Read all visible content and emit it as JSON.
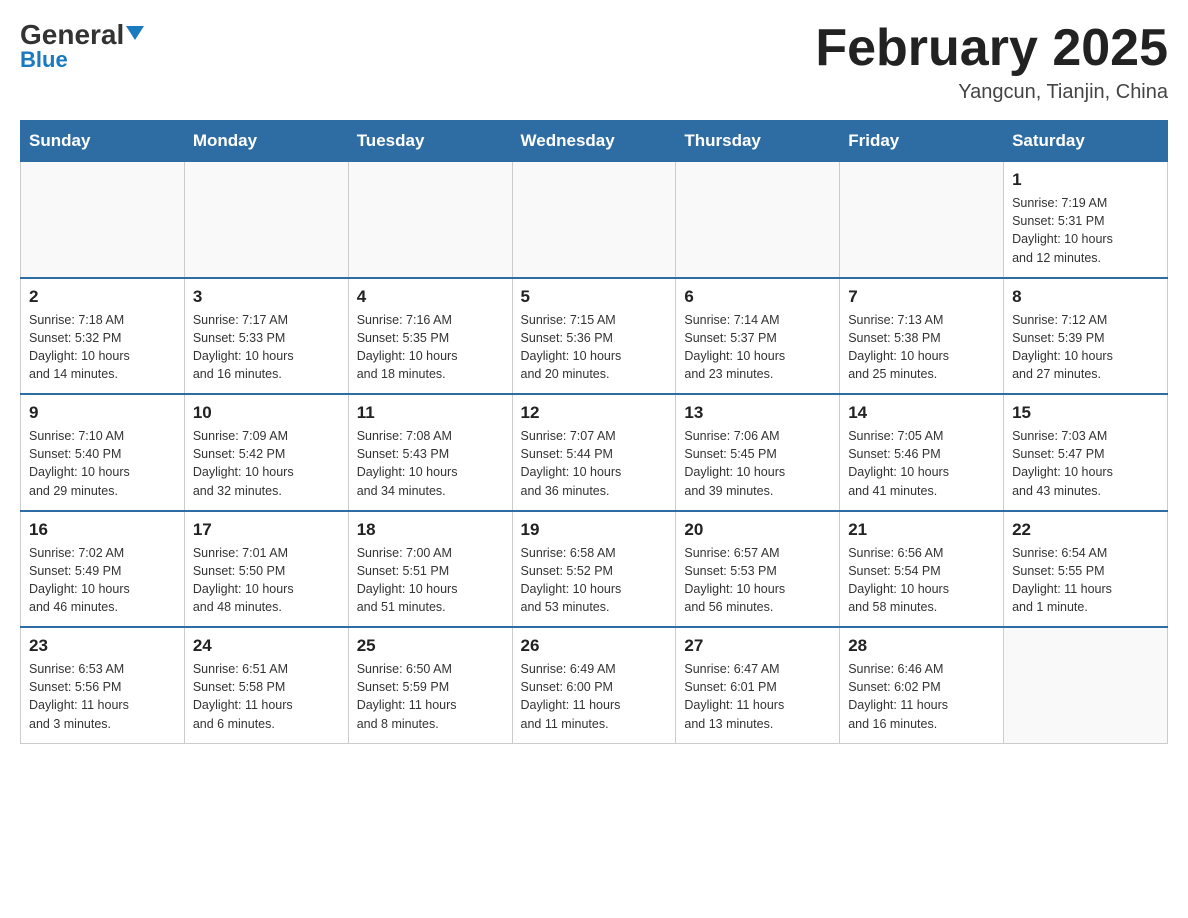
{
  "header": {
    "logo_general": "General",
    "logo_blue": "Blue",
    "month_title": "February 2025",
    "subtitle": "Yangcun, Tianjin, China"
  },
  "weekdays": [
    "Sunday",
    "Monday",
    "Tuesday",
    "Wednesday",
    "Thursday",
    "Friday",
    "Saturday"
  ],
  "weeks": [
    [
      {
        "day": "",
        "info": ""
      },
      {
        "day": "",
        "info": ""
      },
      {
        "day": "",
        "info": ""
      },
      {
        "day": "",
        "info": ""
      },
      {
        "day": "",
        "info": ""
      },
      {
        "day": "",
        "info": ""
      },
      {
        "day": "1",
        "info": "Sunrise: 7:19 AM\nSunset: 5:31 PM\nDaylight: 10 hours\nand 12 minutes."
      }
    ],
    [
      {
        "day": "2",
        "info": "Sunrise: 7:18 AM\nSunset: 5:32 PM\nDaylight: 10 hours\nand 14 minutes."
      },
      {
        "day": "3",
        "info": "Sunrise: 7:17 AM\nSunset: 5:33 PM\nDaylight: 10 hours\nand 16 minutes."
      },
      {
        "day": "4",
        "info": "Sunrise: 7:16 AM\nSunset: 5:35 PM\nDaylight: 10 hours\nand 18 minutes."
      },
      {
        "day": "5",
        "info": "Sunrise: 7:15 AM\nSunset: 5:36 PM\nDaylight: 10 hours\nand 20 minutes."
      },
      {
        "day": "6",
        "info": "Sunrise: 7:14 AM\nSunset: 5:37 PM\nDaylight: 10 hours\nand 23 minutes."
      },
      {
        "day": "7",
        "info": "Sunrise: 7:13 AM\nSunset: 5:38 PM\nDaylight: 10 hours\nand 25 minutes."
      },
      {
        "day": "8",
        "info": "Sunrise: 7:12 AM\nSunset: 5:39 PM\nDaylight: 10 hours\nand 27 minutes."
      }
    ],
    [
      {
        "day": "9",
        "info": "Sunrise: 7:10 AM\nSunset: 5:40 PM\nDaylight: 10 hours\nand 29 minutes."
      },
      {
        "day": "10",
        "info": "Sunrise: 7:09 AM\nSunset: 5:42 PM\nDaylight: 10 hours\nand 32 minutes."
      },
      {
        "day": "11",
        "info": "Sunrise: 7:08 AM\nSunset: 5:43 PM\nDaylight: 10 hours\nand 34 minutes."
      },
      {
        "day": "12",
        "info": "Sunrise: 7:07 AM\nSunset: 5:44 PM\nDaylight: 10 hours\nand 36 minutes."
      },
      {
        "day": "13",
        "info": "Sunrise: 7:06 AM\nSunset: 5:45 PM\nDaylight: 10 hours\nand 39 minutes."
      },
      {
        "day": "14",
        "info": "Sunrise: 7:05 AM\nSunset: 5:46 PM\nDaylight: 10 hours\nand 41 minutes."
      },
      {
        "day": "15",
        "info": "Sunrise: 7:03 AM\nSunset: 5:47 PM\nDaylight: 10 hours\nand 43 minutes."
      }
    ],
    [
      {
        "day": "16",
        "info": "Sunrise: 7:02 AM\nSunset: 5:49 PM\nDaylight: 10 hours\nand 46 minutes."
      },
      {
        "day": "17",
        "info": "Sunrise: 7:01 AM\nSunset: 5:50 PM\nDaylight: 10 hours\nand 48 minutes."
      },
      {
        "day": "18",
        "info": "Sunrise: 7:00 AM\nSunset: 5:51 PM\nDaylight: 10 hours\nand 51 minutes."
      },
      {
        "day": "19",
        "info": "Sunrise: 6:58 AM\nSunset: 5:52 PM\nDaylight: 10 hours\nand 53 minutes."
      },
      {
        "day": "20",
        "info": "Sunrise: 6:57 AM\nSunset: 5:53 PM\nDaylight: 10 hours\nand 56 minutes."
      },
      {
        "day": "21",
        "info": "Sunrise: 6:56 AM\nSunset: 5:54 PM\nDaylight: 10 hours\nand 58 minutes."
      },
      {
        "day": "22",
        "info": "Sunrise: 6:54 AM\nSunset: 5:55 PM\nDaylight: 11 hours\nand 1 minute."
      }
    ],
    [
      {
        "day": "23",
        "info": "Sunrise: 6:53 AM\nSunset: 5:56 PM\nDaylight: 11 hours\nand 3 minutes."
      },
      {
        "day": "24",
        "info": "Sunrise: 6:51 AM\nSunset: 5:58 PM\nDaylight: 11 hours\nand 6 minutes."
      },
      {
        "day": "25",
        "info": "Sunrise: 6:50 AM\nSunset: 5:59 PM\nDaylight: 11 hours\nand 8 minutes."
      },
      {
        "day": "26",
        "info": "Sunrise: 6:49 AM\nSunset: 6:00 PM\nDaylight: 11 hours\nand 11 minutes."
      },
      {
        "day": "27",
        "info": "Sunrise: 6:47 AM\nSunset: 6:01 PM\nDaylight: 11 hours\nand 13 minutes."
      },
      {
        "day": "28",
        "info": "Sunrise: 6:46 AM\nSunset: 6:02 PM\nDaylight: 11 hours\nand 16 minutes."
      },
      {
        "day": "",
        "info": ""
      }
    ]
  ]
}
